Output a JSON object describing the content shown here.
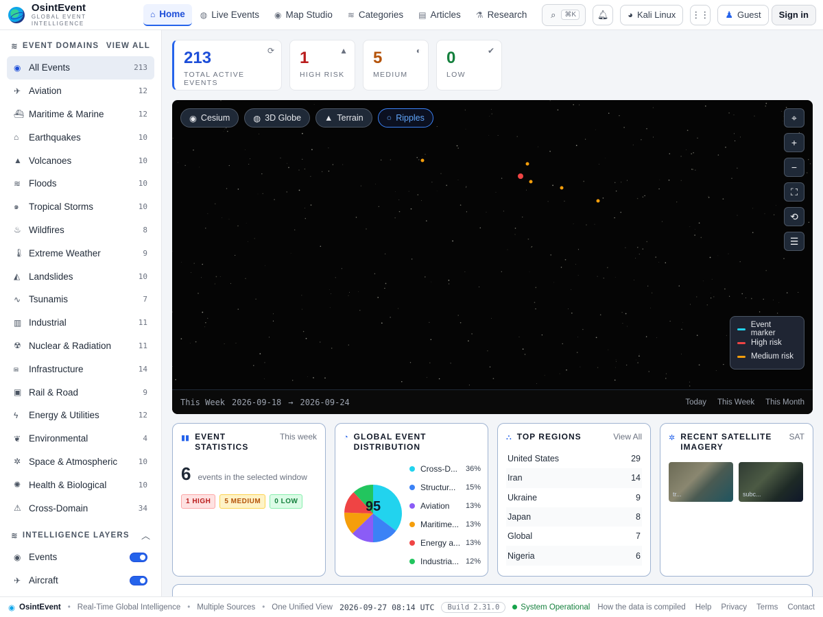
{
  "brand": {
    "name": "OsintEvent",
    "tagline": "GLOBAL EVENT INTELLIGENCE"
  },
  "nav": [
    {
      "label": "Home",
      "icon": "home-icon",
      "active": true
    },
    {
      "label": "Live Events",
      "icon": "signal-icon"
    },
    {
      "label": "Map Studio",
      "icon": "globe-icon"
    },
    {
      "label": "Categories",
      "icon": "layers-icon"
    },
    {
      "label": "Articles",
      "icon": "newspaper-icon"
    },
    {
      "label": "Research",
      "icon": "flask-icon"
    }
  ],
  "topbar": {
    "search_shortcut": "⌘K",
    "distro": "Kali Linux",
    "guest": "Guest",
    "signin": "Sign in"
  },
  "sidebar": {
    "domains_title": "EVENT DOMAINS",
    "view_all": "VIEW ALL",
    "items": [
      {
        "label": "All Events",
        "count": "213",
        "icon": "globe-icon"
      },
      {
        "label": "Aviation",
        "count": "12",
        "icon": "plane-icon"
      },
      {
        "label": "Maritime & Marine",
        "count": "12",
        "icon": "ship-icon"
      },
      {
        "label": "Earthquakes",
        "count": "10",
        "icon": "house-icon"
      },
      {
        "label": "Volcanoes",
        "count": "10",
        "icon": "mountain-icon"
      },
      {
        "label": "Floods",
        "count": "10",
        "icon": "water-icon"
      },
      {
        "label": "Tropical Storms",
        "count": "10",
        "icon": "hurricane-icon"
      },
      {
        "label": "Wildfires",
        "count": "8",
        "icon": "fire-icon"
      },
      {
        "label": "Extreme Weather",
        "count": "9",
        "icon": "thermometer-icon"
      },
      {
        "label": "Landslides",
        "count": "10",
        "icon": "hill-icon"
      },
      {
        "label": "Tsunamis",
        "count": "7",
        "icon": "wave-icon"
      },
      {
        "label": "Industrial",
        "count": "11",
        "icon": "factory-icon"
      },
      {
        "label": "Nuclear & Radiation",
        "count": "11",
        "icon": "radiation-icon"
      },
      {
        "label": "Infrastructure",
        "count": "14",
        "icon": "bridge-icon"
      },
      {
        "label": "Rail & Road",
        "count": "9",
        "icon": "train-icon"
      },
      {
        "label": "Energy & Utilities",
        "count": "12",
        "icon": "bolt-icon"
      },
      {
        "label": "Environmental",
        "count": "4",
        "icon": "leaf-icon"
      },
      {
        "label": "Space & Atmospheric",
        "count": "10",
        "icon": "satellite-icon"
      },
      {
        "label": "Health & Biological",
        "count": "10",
        "icon": "virus-icon"
      },
      {
        "label": "Cross-Domain",
        "count": "34",
        "icon": "warning-icon"
      }
    ],
    "layers_title": "INTELLIGENCE LAYERS",
    "layers": [
      {
        "label": "Events",
        "icon": "dot-circle-icon",
        "on": true
      },
      {
        "label": "Aircraft",
        "icon": "plane-icon",
        "on": true
      }
    ]
  },
  "stats": {
    "total": {
      "value": "213",
      "label": "TOTAL ACTIVE EVENTS",
      "color": "#1d4ed8"
    },
    "high": {
      "value": "1",
      "label": "HIGH RISK",
      "color": "#b91c1c"
    },
    "medium": {
      "value": "5",
      "label": "MEDIUM",
      "color": "#b45309"
    },
    "low": {
      "value": "0",
      "label": "LOW",
      "color": "#15803d"
    }
  },
  "map": {
    "chips": [
      "Cesium",
      "3D Globe",
      "Terrain",
      "Ripples"
    ],
    "legend": [
      {
        "label": "Event marker",
        "color": "#22d3ee"
      },
      {
        "label": "High risk",
        "color": "#ef4444"
      },
      {
        "label": "Medium risk",
        "color": "#f59e0b"
      }
    ],
    "range_label": "This Week",
    "range_start": "2026-09-18",
    "range_arrow": "→",
    "range_end": "2026-09-24",
    "range_links": [
      "Today",
      "This Week",
      "This Month"
    ]
  },
  "cards": {
    "stats": {
      "title": "EVENT STATISTICS",
      "action": "This week",
      "count": "6",
      "sub": "events in the selected window",
      "badge_high": "1 HIGH",
      "badge_medium": "5 MEDIUM",
      "badge_low": "0 LOW"
    },
    "distribution": {
      "title": "GLOBAL EVENT DISTRIBUTION",
      "total": "95"
    },
    "regions": {
      "title": "TOP REGIONS",
      "action": "View All",
      "rows": [
        {
          "name": "United States",
          "count": "29"
        },
        {
          "name": "Iran",
          "count": "14"
        },
        {
          "name": "Ukraine",
          "count": "9"
        },
        {
          "name": "Japan",
          "count": "8"
        },
        {
          "name": "Global",
          "count": "7"
        },
        {
          "name": "Nigeria",
          "count": "6"
        }
      ]
    },
    "satellite": {
      "title": "RECENT SATELLITE IMAGERY",
      "action": "SAT",
      "captions": [
        "tr...",
        "subc..."
      ]
    }
  },
  "chart_data": {
    "type": "pie",
    "categories": [
      "Cross-D...",
      "Structur...",
      "Aviation",
      "Maritime...",
      "Energy a...",
      "Industria..."
    ],
    "values": [
      36,
      15,
      13,
      13,
      13,
      12
    ],
    "value_labels": [
      "36%",
      "15%",
      "13%",
      "13%",
      "13%",
      "12%"
    ],
    "colors": [
      "#22d3ee",
      "#3b82f6",
      "#8b5cf6",
      "#f59e0b",
      "#ef4444",
      "#22c55e"
    ]
  },
  "footer": {
    "brand": "OsintEvent",
    "tagline1": "Real-Time Global Intelligence",
    "tagline2": "Multiple Sources",
    "tagline3": "One Unified View",
    "time": "2026-09-27 08:14 UTC",
    "build": "Build 2.31.0",
    "status": "System Operational",
    "links": [
      "How the data is compiled",
      "Help",
      "Privacy",
      "Terms",
      "Contact"
    ]
  }
}
